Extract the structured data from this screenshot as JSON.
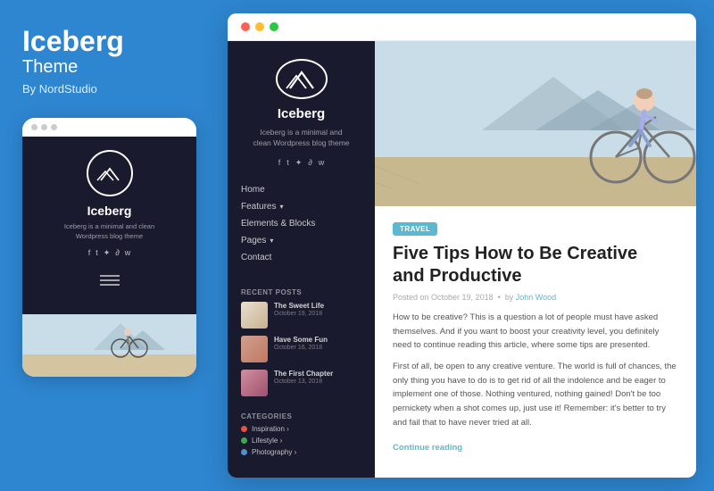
{
  "left": {
    "title": "Iceberg",
    "subtitle": "Theme",
    "by": "By NordStudio"
  },
  "mobile_mockup": {
    "dots": [
      "gray",
      "gray",
      "gray"
    ],
    "brand_name": "Iceberg",
    "brand_desc": "Iceberg is a minimal and clean\nWordpress blog theme"
  },
  "browser": {
    "dots": [
      "red",
      "yellow",
      "green"
    ]
  },
  "sidebar": {
    "brand_name": "Iceberg",
    "brand_desc": "Iceberg is a minimal and\nclean Wordpress blog theme",
    "social_icons": [
      "f",
      "t",
      "i",
      "d",
      "w"
    ],
    "nav_items": [
      {
        "label": "Home",
        "has_arrow": false
      },
      {
        "label": "Features",
        "has_arrow": true
      },
      {
        "label": "Elements & Blocks",
        "has_arrow": false
      },
      {
        "label": "Pages",
        "has_arrow": true
      },
      {
        "label": "Contact",
        "has_arrow": false
      }
    ],
    "recent_posts_title": "RECENT POSTS",
    "recent_posts": [
      {
        "title": "The Sweet Life",
        "date": "October 19, 2018"
      },
      {
        "title": "Have Some Fun",
        "date": "October 16, 2018"
      },
      {
        "title": "The First Chapter",
        "date": "October 13, 2018"
      }
    ],
    "categories_title": "CATEGORIES",
    "categories": [
      {
        "label": "Inspiration ›",
        "color": "#e85040"
      },
      {
        "label": "Lifestyle ›",
        "color": "#40a850"
      },
      {
        "label": "Photography ›",
        "color": "#5090d0"
      }
    ]
  },
  "article": {
    "tag": "TRAVEL",
    "title": "Five Tips How to Be Creative\nand Productive",
    "meta": "Posted on October 19, 2018  •  by John Wood",
    "body_1": "How to be creative? This is a question a lot of people must have asked themselves. And if you want to boost your creativity level, you definitely need to continue reading this article, where some tips are presented.",
    "body_2": "First of all, be open to any creative venture. The world is full of chances, the only thing you have to do is to get rid of all the indolence and be eager to implement one of those. Nothing ventured, nothing gained! Don't be too pernickety when a shot comes up, just use it! Remember: it's better to try and fail that to have never tried at all.",
    "continue_reading": "Continue reading"
  }
}
